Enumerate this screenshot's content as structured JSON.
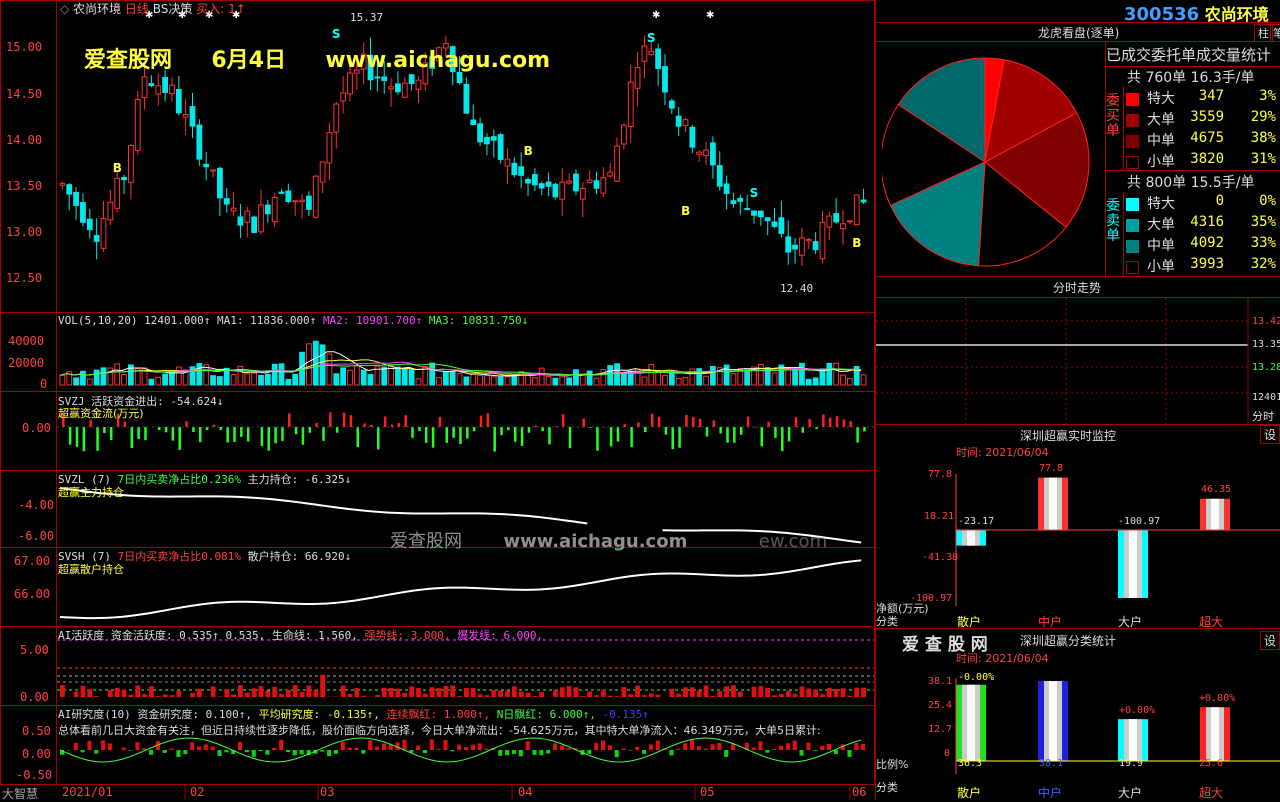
{
  "stock": {
    "code": "300536",
    "name": "农尚环境"
  },
  "chart_header": {
    "name": "农尚环境",
    "period": "日线",
    "strategy": "BS决策",
    "buy_label": "买入:",
    "buy_value": "1↑"
  },
  "watermark": {
    "site": "爱查股网",
    "date": "6月4日",
    "url": "www.aichagu.com",
    "mid": "爱查股网",
    "mid_url": "www.aichagu.com",
    "mid_tail": "ew.com"
  },
  "price_axis": [
    "15.00",
    "14.50",
    "14.00",
    "13.50",
    "13.00",
    "12.50"
  ],
  "annot": {
    "high": "15.37",
    "low": "12.40"
  },
  "vol": {
    "name": "VOL(5,10,20)",
    "v": "12401.000↑",
    "ma1": "MA1: 11836.000↑",
    "ma2": "MA2: 10901.700↑",
    "ma3": "MA3: 10831.750↓",
    "axis": [
      "40000",
      "20000",
      "0"
    ]
  },
  "svzj": {
    "name": "SVZJ",
    "t1": "活跃资金进出: -54.624↓",
    "t2": "超赢资金流(万元)",
    "axis": [
      "0.00"
    ]
  },
  "svzl": {
    "name": "SVZL (7)",
    "t1": "7日内买卖净占比0.236%",
    "t2": "主力持仓: -6.325↓",
    "t3": "超赢主力持仓",
    "axis": [
      "-4.00",
      "-6.00"
    ]
  },
  "svsh": {
    "name": "SVSH (7)",
    "t1": "7日内买卖净占比0.081%",
    "t2": "散户持仓: 66.920↓",
    "t3": "超赢散户持仓",
    "axis": [
      "67.00",
      "66.00"
    ]
  },
  "ai": {
    "name": "AI活跃度",
    "t1": "资金活跃度: 0.535↑",
    "t2": "0.535,",
    "t3": "生命线: 1.560,",
    "t4": "强势线: 3.000,",
    "t5": "爆发线: 6.000,",
    "axis": [
      "5.00",
      "0.00"
    ]
  },
  "air": {
    "name": "AI研究度(10)",
    "t1": "资金研究度: 0.100↑,",
    "t2": "平均研究度: -0.135↑,",
    "t3": "连续飘红: 1.000↑,",
    "t4": "N日飘红: 6.000↑,",
    "t5": "-0.135↑",
    "summary": "总体看前几日大资金有关注，但近日持续性逐步降低，股价面临方向选择，今日大单净流出：-54.625万元，其中特大单净流入：46.349万元，大单5日累计:",
    "axis": [
      "0.50",
      "0.00",
      "-0.50"
    ]
  },
  "dates": [
    "2021/01",
    "02",
    "03",
    "04",
    "05",
    "06"
  ],
  "brand": "大智慧",
  "right": {
    "btn1": "柱",
    "btn2": "笔",
    "lhk_title": "龙虎看盘(逐单)",
    "stat_title": "已成交委托单成交量统计",
    "buy_side": "委买单",
    "sell_side": "委卖单",
    "buy_total": "共 760单 16.3手/单",
    "sell_total": "共 800单 15.5手/单",
    "buy_rows": [
      {
        "k": "特大",
        "n": "347",
        "p": "3%",
        "c": "#ff0000"
      },
      {
        "k": "大单",
        "n": "3559",
        "p": "29%",
        "c": "#a00000"
      },
      {
        "k": "中单",
        "n": "4675",
        "p": "38%",
        "c": "#800000"
      },
      {
        "k": "小单",
        "n": "3820",
        "p": "31%",
        "c": "#000000"
      }
    ],
    "sell_rows": [
      {
        "k": "特大",
        "n": "0",
        "p": "0%",
        "c": "#00ffff"
      },
      {
        "k": "大单",
        "n": "4316",
        "p": "35%",
        "c": "#00a0a0"
      },
      {
        "k": "中单",
        "n": "4092",
        "p": "33%",
        "c": "#008080"
      },
      {
        "k": "小单",
        "n": "3993",
        "p": "32%",
        "c": "#000000"
      }
    ],
    "fs_title": "分时走势",
    "fs_axis": [
      "13.42",
      "13.35",
      "13.28",
      "12401",
      "分时"
    ],
    "jk_title": "深圳超赢实时监控",
    "jk_btn": "设",
    "jk_time": "时间: 2021/06/04",
    "jk_axis": [
      "77.8",
      "18.21",
      "-41.38",
      "-100.97"
    ],
    "jk_unit": "净额(万元)",
    "jk_cat": "分类",
    "jk_vals": [
      "-23.17",
      "77.8",
      "-100.97",
      "46.35"
    ],
    "cats": [
      "散户",
      "中户",
      "大户",
      "超大"
    ],
    "tj_brand": "爱 查 股 网",
    "tj_title": "深圳超赢分类统计",
    "tj_btn": "设",
    "tj_time": "时间: 2021/06/04",
    "tj_axis": [
      "38.1",
      "25.4",
      "12.7",
      "0"
    ],
    "tj_labels": [
      "-0.00%",
      "+0.00%",
      "+0.00%"
    ],
    "tj_vals": [
      "36.3",
      "38.1",
      "19.9",
      "25.6"
    ],
    "tj_unit": "比例%",
    "tj_cat": "分类"
  }
}
